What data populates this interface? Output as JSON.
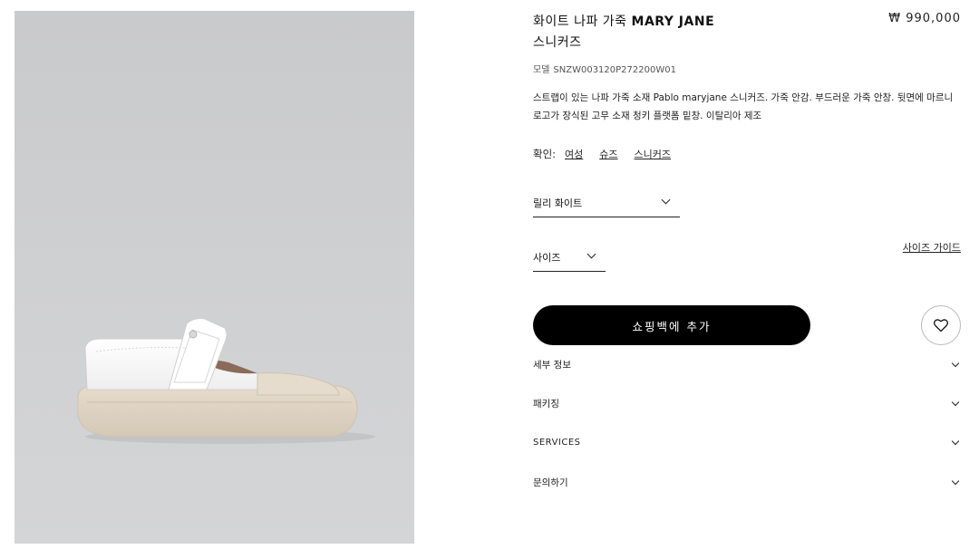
{
  "product": {
    "title_korean": "화이트 나파 가죽",
    "title_latin": "MARY JANE",
    "title_suffix": "스니커즈",
    "price": "₩ 990,000",
    "model_label": "모델",
    "model_code": "SNZW003120P272200W01",
    "description": "스트랩이 있는 나파 가죽 소재 Pablo maryjane 스니커즈. 가죽 안감. 부드러운 가죽 안창. 뒷면에 마르니 로고가 장식된 고무 소재 청키 플랫폼 밑창. 이탈리아 제조"
  },
  "confirm": {
    "label": "확인:",
    "links": [
      "여성",
      "슈즈",
      "스니커즈"
    ]
  },
  "color_select": {
    "value": "릴리 화이트"
  },
  "size_select": {
    "value": "사이즈"
  },
  "size_guide": "사이즈 가이드",
  "add_to_bag": "쇼핑백에 추가",
  "accordion": [
    "세부 정보",
    "패키징",
    "SERVICES",
    "문의하기"
  ],
  "icons": {
    "wishlist": "heart-icon",
    "dropdown": "chevron-down-icon"
  },
  "colors": {
    "background": "#ffffff",
    "image_background": "#cdcecf",
    "button": "#000000",
    "button_text": "#ffffff"
  }
}
